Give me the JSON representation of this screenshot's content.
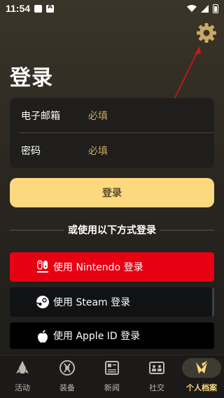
{
  "status_bar": {
    "time": "11:54"
  },
  "page": {
    "title": "登录"
  },
  "form": {
    "email_label": "电子邮箱",
    "email_placeholder": "必填",
    "password_label": "密码",
    "password_placeholder": "必填"
  },
  "login_button": "登录",
  "alt_login_text": "或使用以下方式登录",
  "providers": [
    {
      "label": "使用 Nintendo 登录",
      "icon": "nintendo-switch-icon",
      "color": "#e60012"
    },
    {
      "label": "使用 Steam 登录",
      "icon": "steam-icon",
      "color": "#111214"
    },
    {
      "label": "使用 Apple ID 登录",
      "icon": "apple-icon",
      "color": "#000000"
    }
  ],
  "tabs": [
    {
      "label": "活动",
      "icon": "rocket-icon",
      "active": false
    },
    {
      "label": "装备",
      "icon": "equipment-icon",
      "active": false
    },
    {
      "label": "新闻",
      "icon": "newspaper-icon",
      "active": false
    },
    {
      "label": "社交",
      "icon": "social-icon",
      "active": false
    },
    {
      "label": "个人档案",
      "icon": "profile-emblem-icon",
      "active": true
    }
  ],
  "colors": {
    "accent": "#fcd97f",
    "placeholder": "#c9a865",
    "nintendo": "#e60012"
  }
}
